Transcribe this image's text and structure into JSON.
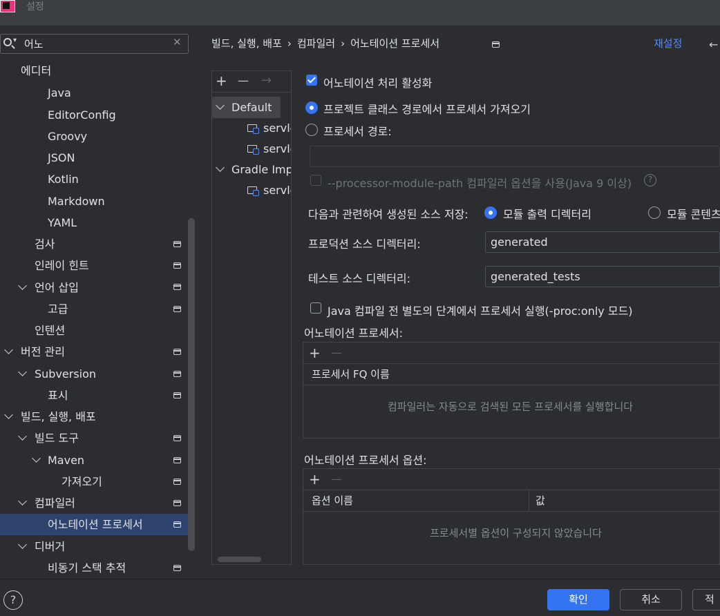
{
  "window": {
    "title": "설정"
  },
  "search": {
    "value": "어노",
    "clear_glyph": "✕"
  },
  "sidebar": {
    "items": [
      {
        "label": "에디터"
      },
      {
        "label": "Java"
      },
      {
        "label": "EditorConfig"
      },
      {
        "label": "Groovy"
      },
      {
        "label": "JSON"
      },
      {
        "label": "Kotlin"
      },
      {
        "label": "Markdown"
      },
      {
        "label": "YAML"
      },
      {
        "label": "검사"
      },
      {
        "label": "인레이 힌트"
      },
      {
        "label": "언어 삽입"
      },
      {
        "label": "고급"
      },
      {
        "label": "인텐션"
      },
      {
        "label": "버전 관리"
      },
      {
        "label": "Subversion"
      },
      {
        "label": "표시"
      },
      {
        "label": "빌드, 실행, 배포"
      },
      {
        "label": "빌드 도구"
      },
      {
        "label": "Maven"
      },
      {
        "label": "가져오기"
      },
      {
        "label": "컴파일러"
      },
      {
        "label": "어노테이션 프로세서"
      },
      {
        "label": "디버거"
      },
      {
        "label": "비동기 스택 추적"
      }
    ]
  },
  "breadcrumb": {
    "part1": "빌드, 실행, 배포",
    "part2": "컴파일러",
    "part3": "어노테이션 프로세서",
    "sep": "›"
  },
  "header": {
    "reset_label": "재설정",
    "back_glyph": "←"
  },
  "profiles": {
    "toolbar": {
      "add": "+",
      "remove": "—",
      "move": "→"
    },
    "items": [
      {
        "label": "Default"
      },
      {
        "label": "servle"
      },
      {
        "label": "servle"
      },
      {
        "label": "Gradle Impo"
      },
      {
        "label": "servle"
      }
    ]
  },
  "settings": {
    "enable_processing": "어노테이션 처리 활성화",
    "obtain_from_classpath": "프로젝트 클래스 경로에서 프로세서 가져오기",
    "processor_path": "프로세서 경로:",
    "processor_path_value": "",
    "module_path_option": "--processor-module-path 컴파일러 옵션을 사용(Java 9 이상)",
    "help_glyph": "?",
    "store_sources_label": "다음과 관련하여 생성된 소스 저장:",
    "module_output_dir": "모듈 출력 디렉터리",
    "module_content_root": "모듈 콘텐츠",
    "production_dir_label": "프로덕션 소스 디렉터리:",
    "production_dir_value": "generated",
    "test_dir_label": "테스트 소스 디렉터리:",
    "test_dir_value": "generated_tests",
    "separate_step": "Java 컴파일 전 별도의 단계에서 프로세서 실행(-proc:only 모드)"
  },
  "processors_table": {
    "title": "어노테이션 프로세서:",
    "add": "+",
    "remove": "—",
    "column": "프로세서 FQ 이름",
    "empty": "컴파일러는 자동으로 검색된 모든 프로세서를 실행합니다"
  },
  "options_table": {
    "title": "어노테이션 프로세서 옵션:",
    "add": "+",
    "remove": "—",
    "col_name": "옵션 이름",
    "col_value": "값",
    "empty": "프로세서별 옵션이 구성되지 않았습니다"
  },
  "footer": {
    "help_glyph": "?",
    "ok": "확인",
    "cancel": "취소",
    "apply": "적용"
  },
  "colors": {
    "accent": "#3574f0",
    "link": "#548af7",
    "selection": "#2e436e",
    "background": "#2b2d30"
  }
}
